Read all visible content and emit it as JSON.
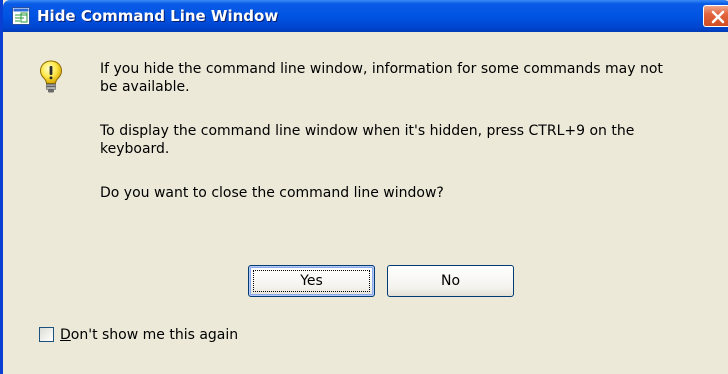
{
  "window": {
    "title": "Hide Command Line Window",
    "close_icon": "close-icon",
    "app_icon": "command-line-icon"
  },
  "message": {
    "icon": "lightbulb-warning-icon",
    "line1": "If you hide the command line window, information for some commands may not be available.",
    "line2": "To display the command line window when it's hidden, press CTRL+9 on the keyboard.",
    "line3": "Do you want to close the command line window?"
  },
  "buttons": {
    "yes_label": "Yes",
    "no_label": "No"
  },
  "checkbox": {
    "mnemonic": "D",
    "label_rest": "on't show me this again",
    "checked": false
  },
  "colors": {
    "titlebar": "#0054e3",
    "dialog_bg": "#ece9d8",
    "close_button": "#d24c20"
  }
}
